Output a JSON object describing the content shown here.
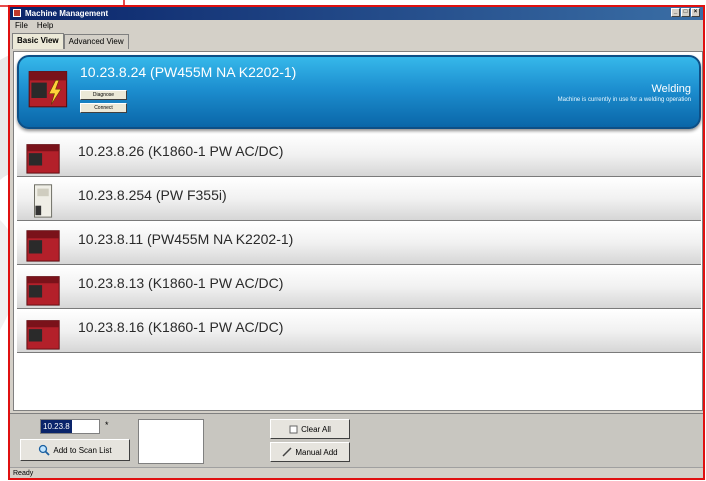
{
  "window": {
    "title": "Machine Management",
    "status_text": "Ready"
  },
  "menu": [
    "File",
    "Help"
  ],
  "tabs": [
    {
      "label": "Basic View",
      "active": true
    },
    {
      "label": "Advanced View",
      "active": false
    }
  ],
  "machines": [
    {
      "label": "10.23.8.24 (PW455M NA K2202-1)",
      "selected": true,
      "icon": "welder-red-icon",
      "status": "Welding",
      "status_description": "Machine is currently in use for a welding operation",
      "actions": [
        "Diagnose",
        "Connect"
      ]
    },
    {
      "label": "10.23.8.26 (K1860-1 PW AC/DC)",
      "selected": false,
      "icon": "welder-red-icon"
    },
    {
      "label": "10.23.8.254 (PW F355i)",
      "selected": false,
      "icon": "welder-white-icon"
    },
    {
      "label": "10.23.8.11 (PW455M NA K2202-1)",
      "selected": false,
      "icon": "welder-red-icon"
    },
    {
      "label": "10.23.8.13 (K1860-1 PW AC/DC)",
      "selected": false,
      "icon": "welder-red-icon"
    },
    {
      "label": "10.23.8.16 (K1860-1 PW AC/DC)",
      "selected": false,
      "icon": "welder-red-icon"
    }
  ],
  "controls": {
    "ip_value": "10.23.8",
    "ip_marker": "*",
    "add_to_scan_list": "Add to Scan List",
    "clear_all": "Clear All",
    "manual_add": "Manual Add"
  },
  "colors": {
    "selection_blue": "#1d8fd0",
    "frame_red": "#e01010",
    "titlebar_navy": "#0a246a"
  }
}
